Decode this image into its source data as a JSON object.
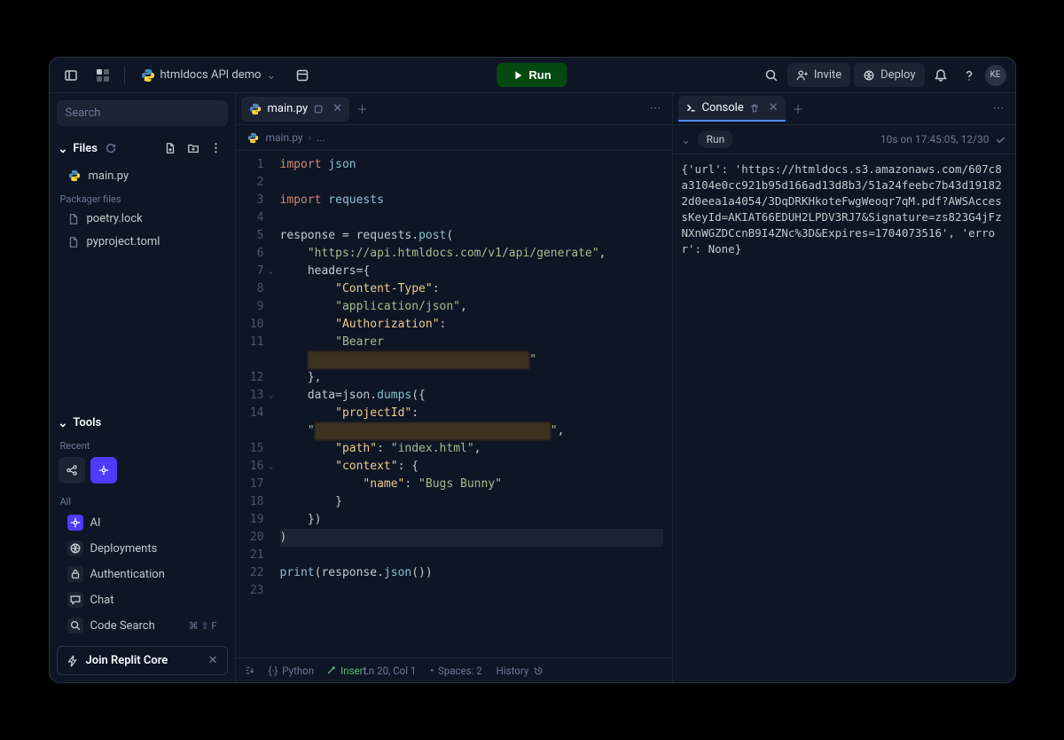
{
  "topbar": {
    "project_name": "htmldocs API demo",
    "run_label": "Run",
    "invite_label": "Invite",
    "deploy_label": "Deploy",
    "avatar_initials": "KE"
  },
  "sidebar": {
    "search_placeholder": "Search",
    "files_label": "Files",
    "files": [
      "main.py"
    ],
    "packager_label": "Packager files",
    "packager_files": [
      "poetry.lock",
      "pyproject.toml"
    ],
    "tools_label": "Tools",
    "recent_label": "Recent",
    "all_label": "All",
    "tools": [
      {
        "label": "AI",
        "icon": "ai",
        "active": true
      },
      {
        "label": "Deployments",
        "icon": "deploy"
      },
      {
        "label": "Authentication",
        "icon": "lock"
      },
      {
        "label": "Chat",
        "icon": "chat"
      },
      {
        "label": "Code Search",
        "icon": "search",
        "shortcut": "⌘ ⇧ F"
      }
    ],
    "join_label": "Join Replit Core"
  },
  "editor": {
    "tab_label": "main.py",
    "breadcrumb_file": "main.py",
    "breadcrumb_ellipsis": "...",
    "lines": [
      [
        [
          "kw",
          "import"
        ],
        [
          "sp",
          " "
        ],
        [
          "mod",
          "json"
        ]
      ],
      [],
      [
        [
          "kw",
          "import"
        ],
        [
          "sp",
          " "
        ],
        [
          "mod",
          "requests"
        ]
      ],
      [],
      [
        [
          "var",
          "response"
        ],
        [
          "punc",
          " = "
        ],
        [
          "var",
          "requests"
        ],
        [
          "punc",
          "."
        ],
        [
          "fn",
          "post"
        ],
        [
          "punc",
          "("
        ]
      ],
      [
        [
          "sp",
          "    "
        ],
        [
          "str",
          "\"https://api.htmldocs.com/v1/api/generate\""
        ],
        [
          "punc",
          ","
        ]
      ],
      [
        [
          "sp",
          "    "
        ],
        [
          "var",
          "headers"
        ],
        [
          "punc",
          "="
        ],
        [
          "punc",
          "{"
        ]
      ],
      [
        [
          "sp",
          "        "
        ],
        [
          "key",
          "\"Content-Type\""
        ],
        [
          "punc",
          ":"
        ]
      ],
      [
        [
          "sp",
          "        "
        ],
        [
          "str",
          "\"application/json\""
        ],
        [
          "punc",
          ","
        ]
      ],
      [
        [
          "sp",
          "        "
        ],
        [
          "key",
          "\"Authorization\""
        ],
        [
          "punc",
          ":"
        ]
      ],
      [
        [
          "sp",
          "        "
        ],
        [
          "str",
          "\"Bearer"
        ]
      ],
      [
        [
          "sp",
          "    "
        ],
        [
          "redact",
          "xxxxxxxxxxxxxxxxxxxxxxxxxxxxxxxx"
        ],
        [
          "str",
          "\""
        ]
      ],
      [
        [
          "sp",
          "    "
        ],
        [
          "punc",
          "},"
        ]
      ],
      [
        [
          "sp",
          "    "
        ],
        [
          "var",
          "data"
        ],
        [
          "punc",
          "="
        ],
        [
          "var",
          "json"
        ],
        [
          "punc",
          "."
        ],
        [
          "fn",
          "dumps"
        ],
        [
          "punc",
          "({"
        ]
      ],
      [
        [
          "sp",
          "        "
        ],
        [
          "key",
          "\"projectId\""
        ],
        [
          "punc",
          ":"
        ]
      ],
      [
        [
          "sp",
          "    "
        ],
        [
          "str",
          "\""
        ],
        [
          "redact",
          "xxxxxxxxxxxxxxxxxxxxxxxxxxxxxxxxxx"
        ],
        [
          "str",
          "\""
        ],
        [
          "punc",
          ","
        ]
      ],
      [
        [
          "sp",
          "        "
        ],
        [
          "key",
          "\"path\""
        ],
        [
          "punc",
          ": "
        ],
        [
          "str",
          "\"index.html\""
        ],
        [
          "punc",
          ","
        ]
      ],
      [
        [
          "sp",
          "        "
        ],
        [
          "key",
          "\"context\""
        ],
        [
          "punc",
          ": {"
        ]
      ],
      [
        [
          "sp",
          "            "
        ],
        [
          "key",
          "\"name\""
        ],
        [
          "punc",
          ": "
        ],
        [
          "str",
          "\"Bugs Bunny\""
        ]
      ],
      [
        [
          "sp",
          "        "
        ],
        [
          "punc",
          "}"
        ]
      ],
      [
        [
          "sp",
          "    "
        ],
        [
          "punc",
          "})"
        ]
      ],
      [
        [
          "punc",
          ")"
        ]
      ],
      [],
      [
        [
          "fn",
          "print"
        ],
        [
          "punc",
          "("
        ],
        [
          "var",
          "response"
        ],
        [
          "punc",
          "."
        ],
        [
          "fn",
          "json"
        ],
        [
          "punc",
          "())"
        ]
      ],
      []
    ],
    "fold_lines": [
      7,
      13,
      16
    ],
    "highlight_line": 20,
    "gutter_offset": -1
  },
  "statusbar": {
    "language": "Python",
    "mode": "Insert",
    "position": "Ln 20, Col 1",
    "spaces": "Spaces: 2",
    "history": "History"
  },
  "console": {
    "tab_label": "Console",
    "run_label": "Run",
    "meta": "10s on 17:45:05, 12/30",
    "output": "{'url': 'https://htmldocs.s3.amazonaws.com/607c8a3104e0cc921b95d166ad13d8b3/51a24feebc7b43d191822d0eea1a4054/3DqDRKHkoteFwgWeoqr7qM.pdf?AWSAccessKeyId=AKIAT66EDUH2LPDV3RJ7&Signature=zs823G4jFzNXnWGZDCcnB9I4ZNc%3D&Expires=1704073516', 'error': None}"
  }
}
